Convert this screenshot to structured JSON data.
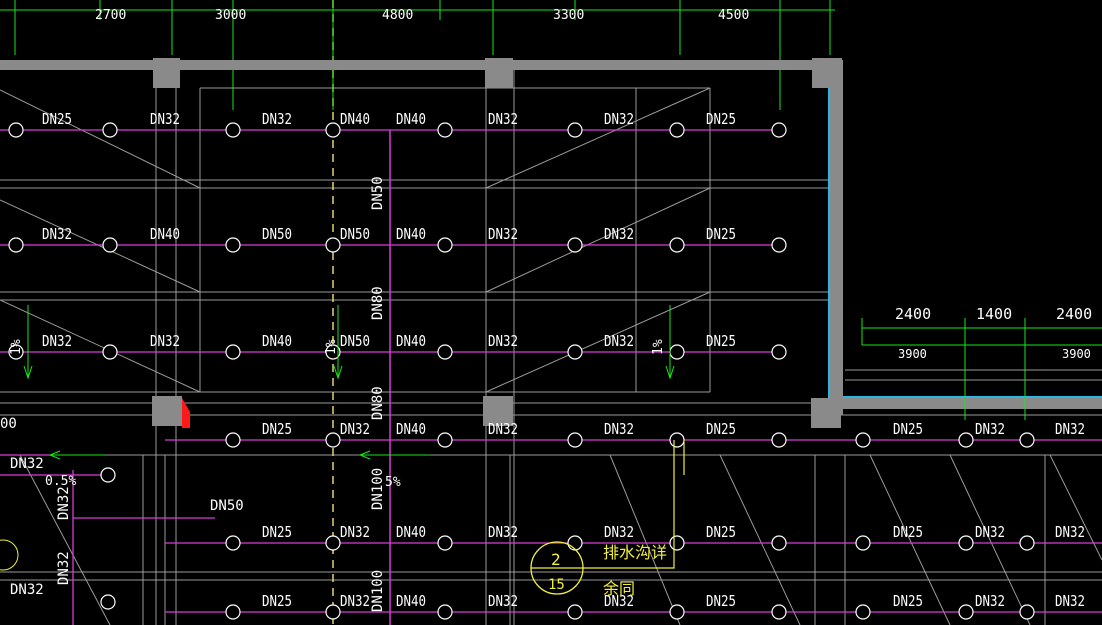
{
  "colors": {
    "background": "#000000",
    "wall": "#8a8a8a",
    "pipe": "#d83cd8",
    "dimension": "#19e619",
    "text": "#ffffff",
    "cyan_edge": "#2ab7e6",
    "annotation": "#f2ef38",
    "grid": "#aaaaaa",
    "red_marker": "#ff1a1a"
  },
  "top_dimensions": [
    "2700",
    "3000",
    "4800",
    "3300",
    "4500"
  ],
  "right_dimensions": {
    "upper": [
      "2400",
      "1400",
      "2400"
    ],
    "lower": [
      "3900",
      "3900"
    ]
  },
  "left_edge_label": "00",
  "pipe_rows": [
    {
      "labels": [
        "DN25",
        "DN32",
        "DN32",
        "DN40",
        "DN40",
        "DN32",
        "DN32",
        "DN25"
      ]
    },
    {
      "labels": [
        "DN32",
        "DN40",
        "DN50",
        "DN50",
        "DN40",
        "DN32",
        "DN32",
        "DN25"
      ]
    },
    {
      "labels": [
        "DN32",
        "DN32",
        "DN40",
        "DN50",
        "DN40",
        "DN32",
        "DN32",
        "DN25"
      ]
    },
    {
      "labels": [
        "DN25",
        "DN32",
        "DN40",
        "DN32",
        "DN32",
        "DN25",
        "DN25",
        "DN32",
        "DN32"
      ]
    },
    {
      "labels": [
        "DN25",
        "DN32",
        "DN40",
        "DN32",
        "DN32",
        "DN25",
        "DN25",
        "DN32",
        "DN32"
      ]
    },
    {
      "labels": [
        "DN25",
        "DN32",
        "DN40",
        "DN32",
        "DN32",
        "DN25",
        "DN25",
        "DN32",
        "DN32"
      ]
    }
  ],
  "vertical_labels": [
    "DN50",
    "DN80",
    "DN80",
    "DN100",
    "DN100"
  ],
  "left_labels": [
    "DN32",
    "DN32",
    "DN32",
    "DN32"
  ],
  "slope_labels": [
    "1%",
    "1%",
    "1%",
    "0.5%",
    "5%"
  ],
  "branch_label": "DN50",
  "detail_callout": {
    "number": "2",
    "sheet": "15",
    "line1": "排水沟详",
    "line2": "余同"
  }
}
